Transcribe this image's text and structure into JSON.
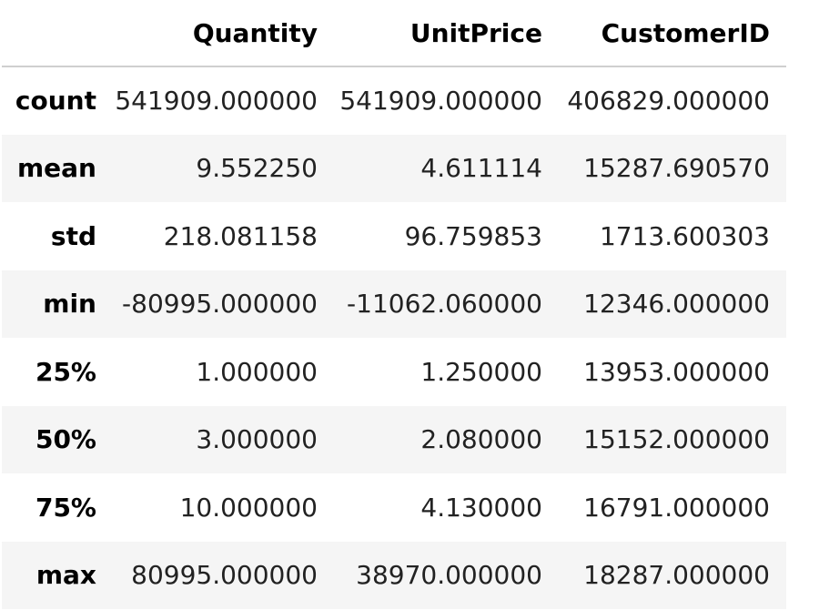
{
  "table": {
    "columns": [
      "",
      "Quantity",
      "UnitPrice",
      "CustomerID"
    ],
    "rows": [
      {
        "index": "count",
        "values": [
          "541909.000000",
          "541909.000000",
          "406829.000000"
        ]
      },
      {
        "index": "mean",
        "values": [
          "9.552250",
          "4.611114",
          "15287.690570"
        ]
      },
      {
        "index": "std",
        "values": [
          "218.081158",
          "96.759853",
          "1713.600303"
        ]
      },
      {
        "index": "min",
        "values": [
          "-80995.000000",
          "-11062.060000",
          "12346.000000"
        ]
      },
      {
        "index": "25%",
        "values": [
          "1.000000",
          "1.250000",
          "13953.000000"
        ]
      },
      {
        "index": "50%",
        "values": [
          "3.000000",
          "2.080000",
          "15152.000000"
        ]
      },
      {
        "index": "75%",
        "values": [
          "10.000000",
          "4.130000",
          "16791.000000"
        ]
      },
      {
        "index": "max",
        "values": [
          "80995.000000",
          "38970.000000",
          "18287.000000"
        ]
      }
    ]
  },
  "colors": {
    "stripe": "#f5f5f5",
    "header_rule": "#cfcfcf"
  }
}
